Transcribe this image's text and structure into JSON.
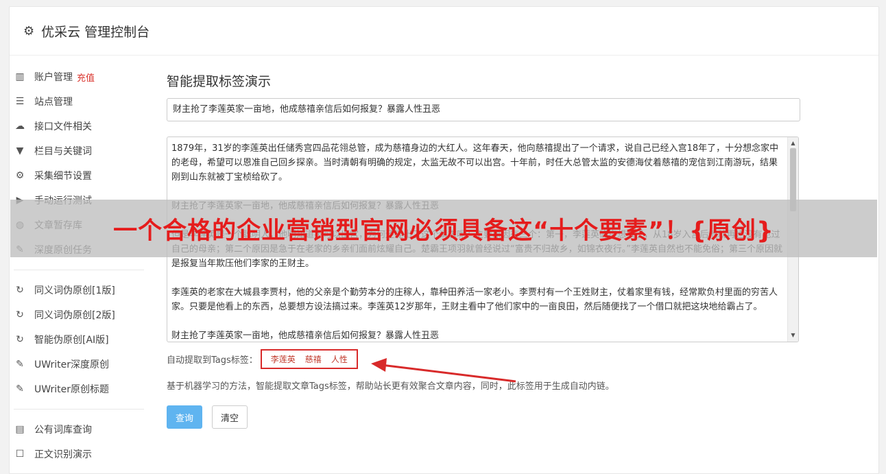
{
  "header": {
    "title": "优采云 管理控制台",
    "icon": "gear-icon"
  },
  "sidebar": {
    "group1": [
      {
        "icon": "bar-chart-icon",
        "glyph": "▥",
        "label": "账户管理",
        "badge": "充值"
      },
      {
        "icon": "server-icon",
        "glyph": "☰",
        "label": "站点管理"
      },
      {
        "icon": "cloud-upload-icon",
        "glyph": "☁",
        "label": "接口文件相关"
      },
      {
        "icon": "filter-icon",
        "glyph": "▼",
        "label": "栏目与关键词"
      },
      {
        "icon": "cogs-icon",
        "glyph": "⚙",
        "label": "采集细节设置"
      },
      {
        "icon": "play-circle-icon",
        "glyph": "▶",
        "label": "手动运行测试"
      },
      {
        "icon": "database-icon",
        "glyph": "◍",
        "label": "文章暂存库"
      },
      {
        "icon": "edit-icon",
        "glyph": "✎",
        "label": "深度原创任务"
      }
    ],
    "group2": [
      {
        "icon": "refresh-icon",
        "glyph": "↻",
        "label": "同义词伪原创[1版]"
      },
      {
        "icon": "refresh-icon",
        "glyph": "↻",
        "label": "同义词伪原创[2版]"
      },
      {
        "icon": "refresh-icon",
        "glyph": "↻",
        "label": "智能伪原创[AI版]"
      },
      {
        "icon": "edit-icon",
        "glyph": "✎",
        "label": "UWriter深度原创"
      },
      {
        "icon": "edit-icon",
        "glyph": "✎",
        "label": "UWriter原创标题"
      }
    ],
    "group3": [
      {
        "icon": "book-icon",
        "glyph": "▤",
        "label": "公有词库查询"
      },
      {
        "icon": "square-icon",
        "glyph": "☐",
        "label": "正文识别演示"
      }
    ]
  },
  "main": {
    "title": "智能提取标签演示",
    "title_input": "财主抢了李莲英家一亩地，他成慈禧亲信后如何报复？暴露人性丑恶",
    "content_paragraphs": [
      "1879年，31岁的李莲英出任储秀宫四品花翎总管，成为慈禧身边的大红人。这年春天，他向慈禧提出了一个请求，说自己已经入宫18年了，十分想念家中的老母，希望可以恩准自己回乡探亲。当时清朝有明确的规定，太监无故不可以出宫。十年前，时任大总管太监的安德海仗着慈禧的宠信到江南游玩，结果刚到山东就被丁宝桢给砍了。",
      "财主抢了李莲英家一亩地，他成慈禧亲信后如何报复？暴露人性丑恶",
      "但是李莲英是一个聪明人，他明知道不可以出宫，为何还提出了这个请求呢？主要原因有三个：第一，李莲英确实想家了，从18岁入宫后他就再也没有见过自己的母亲；第二个原因是急于在老家的乡亲们面前炫耀自己。楚霸王项羽就曾经说过“富贵不归故乡，如锦衣夜行。”李莲英自然也不能免俗；第三个原因就是报复当年欺压他们李家的王财主。",
      "李莲英的老家在大城县李贾村，他的父亲是个勤劳本分的庄稼人，靠种田养活一家老小。李贾村有一个王姓财主，仗着家里有钱，经常欺负村里面的穷苦人家。只要是他看上的东西，总要想方设法搞过来。李莲英12岁那年，王财主看中了他们家中的一亩良田，然后随便找了一个借口就把这块地给霸占了。",
      "财主抢了李莲英家一亩地，他成慈禧亲信后如何报复？暴露人性丑恶"
    ],
    "tags_label": "自动提取到Tags标签：",
    "tags": [
      "李莲英",
      "慈禧",
      "人性"
    ],
    "description": "基于机器学习的方法，智能提取文章Tags标签，帮助站长更有效聚合文章内容，同时，此标签用于生成自动内链。",
    "query_button": "查询",
    "clear_button": "清空"
  },
  "overlay": {
    "text": "一个合格的企业营销型官网必须具备这“十个要素”！{原创}"
  },
  "colors": {
    "accent": "#5fb4f0",
    "highlight": "#d82a2a",
    "badge": "#d9322b"
  }
}
